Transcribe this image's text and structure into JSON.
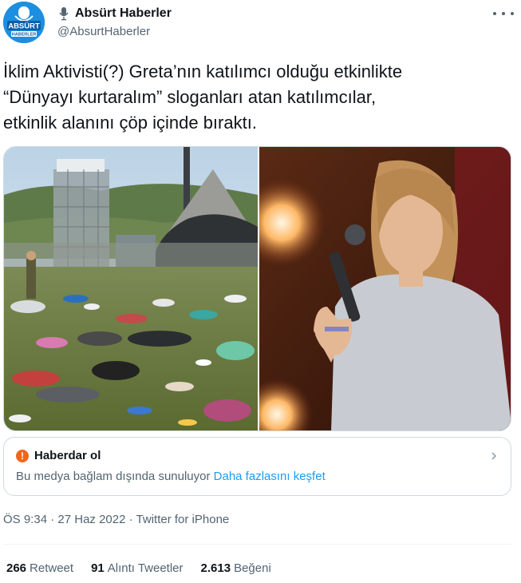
{
  "author": {
    "display_name": "Absürt Haberler",
    "handle": "@AbsurtHaberler",
    "avatar_text_top": "ABSÜRT",
    "avatar_text_bottom": "HABERLER"
  },
  "tweet": {
    "lines": [
      "İklim Aktivisti(?) Greta’nın katılımcı olduğu etkinlikte",
      "“Dünyayı kurtaralım” sloganları atan katılımcılar,",
      "etkinlik alanını çöp içinde bıraktı."
    ]
  },
  "media": {
    "left_image": "festival field covered in litter",
    "right_image": "activist speaking into microphone"
  },
  "notice": {
    "title": "Haberdar ol",
    "body": "Bu medya bağlam dışında sunuluyor",
    "link": "Daha fazlasını keşfet"
  },
  "meta": {
    "time": "ÖS 9:34",
    "date": "27 Haz 2022",
    "source": "Twitter for iPhone"
  },
  "stats": {
    "retweets_count": "266",
    "retweets_label": "Retweet",
    "quotes_count": "91",
    "quotes_label": "Alıntı Tweetler",
    "likes_count": "2.613",
    "likes_label": "Beğeni"
  },
  "colors": {
    "accent": "#1d9bf0",
    "warning": "#f4661b",
    "secondary_text": "#536471"
  }
}
